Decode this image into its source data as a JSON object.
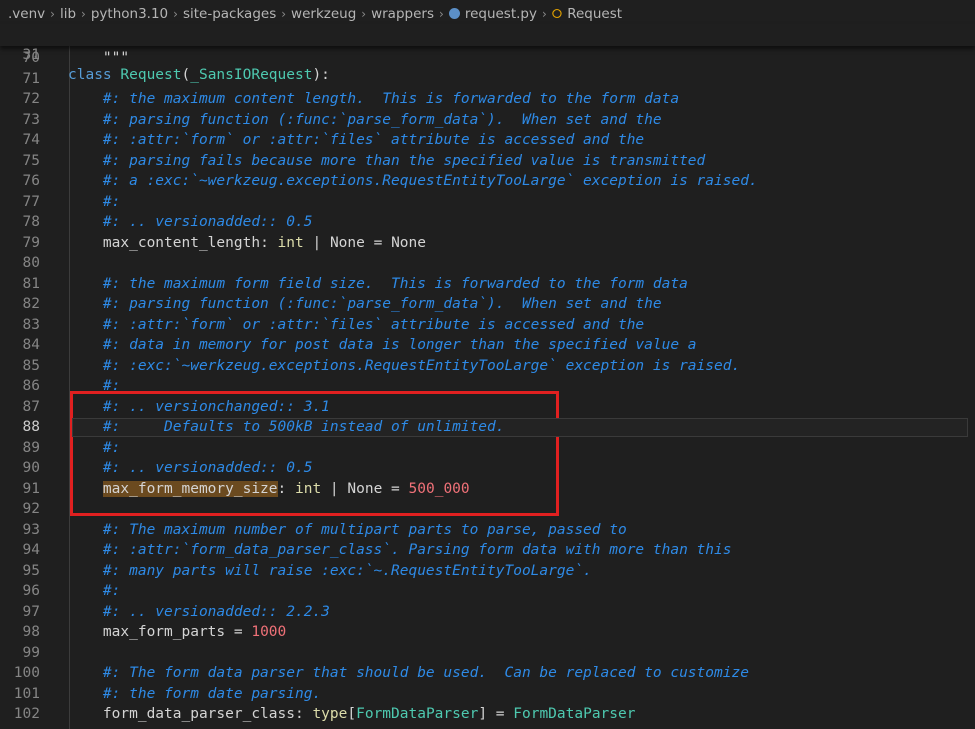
{
  "breadcrumb": [
    {
      "label": ".venv"
    },
    {
      "label": "lib"
    },
    {
      "label": "python3.10"
    },
    {
      "label": "site-packages"
    },
    {
      "label": "werkzeug"
    },
    {
      "label": "wrappers"
    },
    {
      "label": "request.py",
      "icon": "python-file-icon"
    },
    {
      "label": "Request",
      "icon": "class-symbol-icon"
    }
  ],
  "sticky": {
    "line": "31",
    "kw": "class",
    "name": "Request",
    "open": "(",
    "base": "_SansIORequest",
    "close": "):"
  },
  "lines": [
    {
      "n": "70",
      "parts": [
        {
          "c": "pl",
          "t": "    \"\"\""
        }
      ]
    },
    {
      "n": "71",
      "parts": []
    },
    {
      "n": "72",
      "parts": [
        {
          "c": "cm",
          "t": "    #: the maximum content length.  This is forwarded to the form data"
        }
      ]
    },
    {
      "n": "73",
      "parts": [
        {
          "c": "cm",
          "t": "    #: parsing function (:func:`parse_form_data`).  When set and the"
        }
      ]
    },
    {
      "n": "74",
      "parts": [
        {
          "c": "cm",
          "t": "    #: :attr:`form` or :attr:`files` attribute is accessed and the"
        }
      ]
    },
    {
      "n": "75",
      "parts": [
        {
          "c": "cm",
          "t": "    #: parsing fails because more than the specified value is transmitted"
        }
      ]
    },
    {
      "n": "76",
      "parts": [
        {
          "c": "cm",
          "t": "    #: a :exc:`~werkzeug.exceptions.RequestEntityTooLarge` exception is raised."
        }
      ]
    },
    {
      "n": "77",
      "parts": [
        {
          "c": "cm",
          "t": "    #:"
        }
      ]
    },
    {
      "n": "78",
      "parts": [
        {
          "c": "cm",
          "t": "    #: .. versionadded:: 0.5"
        }
      ]
    },
    {
      "n": "79",
      "parts": [
        {
          "c": "var",
          "t": "    max_content_length"
        },
        {
          "c": "pl",
          "t": ": "
        },
        {
          "c": "ty",
          "t": "int"
        },
        {
          "c": "pl",
          "t": " | "
        },
        {
          "c": "pl",
          "t": "None"
        },
        {
          "c": "pl",
          "t": " = "
        },
        {
          "c": "pl",
          "t": "None"
        }
      ]
    },
    {
      "n": "80",
      "parts": []
    },
    {
      "n": "81",
      "parts": [
        {
          "c": "cm",
          "t": "    #: the maximum form field size.  This is forwarded to the form data"
        }
      ]
    },
    {
      "n": "82",
      "parts": [
        {
          "c": "cm",
          "t": "    #: parsing function (:func:`parse_form_data`).  When set and the"
        }
      ]
    },
    {
      "n": "83",
      "parts": [
        {
          "c": "cm",
          "t": "    #: :attr:`form` or :attr:`files` attribute is accessed and the"
        }
      ]
    },
    {
      "n": "84",
      "parts": [
        {
          "c": "cm",
          "t": "    #: data in memory for post data is longer than the specified value a"
        }
      ]
    },
    {
      "n": "85",
      "parts": [
        {
          "c": "cm",
          "t": "    #: :exc:`~werkzeug.exceptions.RequestEntityTooLarge` exception is raised."
        }
      ]
    },
    {
      "n": "86",
      "parts": [
        {
          "c": "cm",
          "t": "    #:"
        }
      ]
    },
    {
      "n": "87",
      "parts": [
        {
          "c": "cm",
          "t": "    #: .. versionchanged:: 3.1"
        }
      ]
    },
    {
      "n": "88",
      "active": true,
      "parts": [
        {
          "c": "cm",
          "t": "    #:     Defaults to 500kB instead of unlimited."
        }
      ]
    },
    {
      "n": "89",
      "parts": [
        {
          "c": "cm",
          "t": "    #:"
        }
      ]
    },
    {
      "n": "90",
      "parts": [
        {
          "c": "cm",
          "t": "    #: .. versionadded:: 0.5"
        }
      ]
    },
    {
      "n": "91",
      "parts": [
        {
          "c": "pl",
          "t": "    "
        },
        {
          "c": "var hl-var",
          "t": "max_form_memory_size"
        },
        {
          "c": "pl",
          "t": ": "
        },
        {
          "c": "ty",
          "t": "int"
        },
        {
          "c": "pl",
          "t": " | "
        },
        {
          "c": "pl",
          "t": "None"
        },
        {
          "c": "pl",
          "t": " = "
        },
        {
          "c": "num",
          "t": "500_000"
        }
      ]
    },
    {
      "n": "92",
      "parts": []
    },
    {
      "n": "93",
      "parts": [
        {
          "c": "cm",
          "t": "    #: The maximum number of multipart parts to parse, passed to"
        }
      ]
    },
    {
      "n": "94",
      "parts": [
        {
          "c": "cm",
          "t": "    #: :attr:`form_data_parser_class`. Parsing form data with more than this"
        }
      ]
    },
    {
      "n": "95",
      "parts": [
        {
          "c": "cm",
          "t": "    #: many parts will raise :exc:`~.RequestEntityTooLarge`."
        }
      ]
    },
    {
      "n": "96",
      "parts": [
        {
          "c": "cm",
          "t": "    #:"
        }
      ]
    },
    {
      "n": "97",
      "parts": [
        {
          "c": "cm",
          "t": "    #: .. versionadded:: 2.2.3"
        }
      ]
    },
    {
      "n": "98",
      "parts": [
        {
          "c": "var",
          "t": "    max_form_parts"
        },
        {
          "c": "pl",
          "t": " = "
        },
        {
          "c": "num",
          "t": "1000"
        }
      ]
    },
    {
      "n": "99",
      "parts": []
    },
    {
      "n": "100",
      "parts": [
        {
          "c": "cm",
          "t": "    #: The form data parser that should be used.  Can be replaced to customize"
        }
      ]
    },
    {
      "n": "101",
      "parts": [
        {
          "c": "cm",
          "t": "    #: the form date parsing."
        }
      ]
    },
    {
      "n": "102",
      "parts": [
        {
          "c": "var",
          "t": "    form_data_parser_class"
        },
        {
          "c": "pl",
          "t": ": "
        },
        {
          "c": "ty",
          "t": "type"
        },
        {
          "c": "pl",
          "t": "["
        },
        {
          "c": "cls",
          "t": "FormDataParser"
        },
        {
          "c": "pl",
          "t": "] = "
        },
        {
          "c": "cls",
          "t": "FormDataParser"
        }
      ]
    }
  ]
}
